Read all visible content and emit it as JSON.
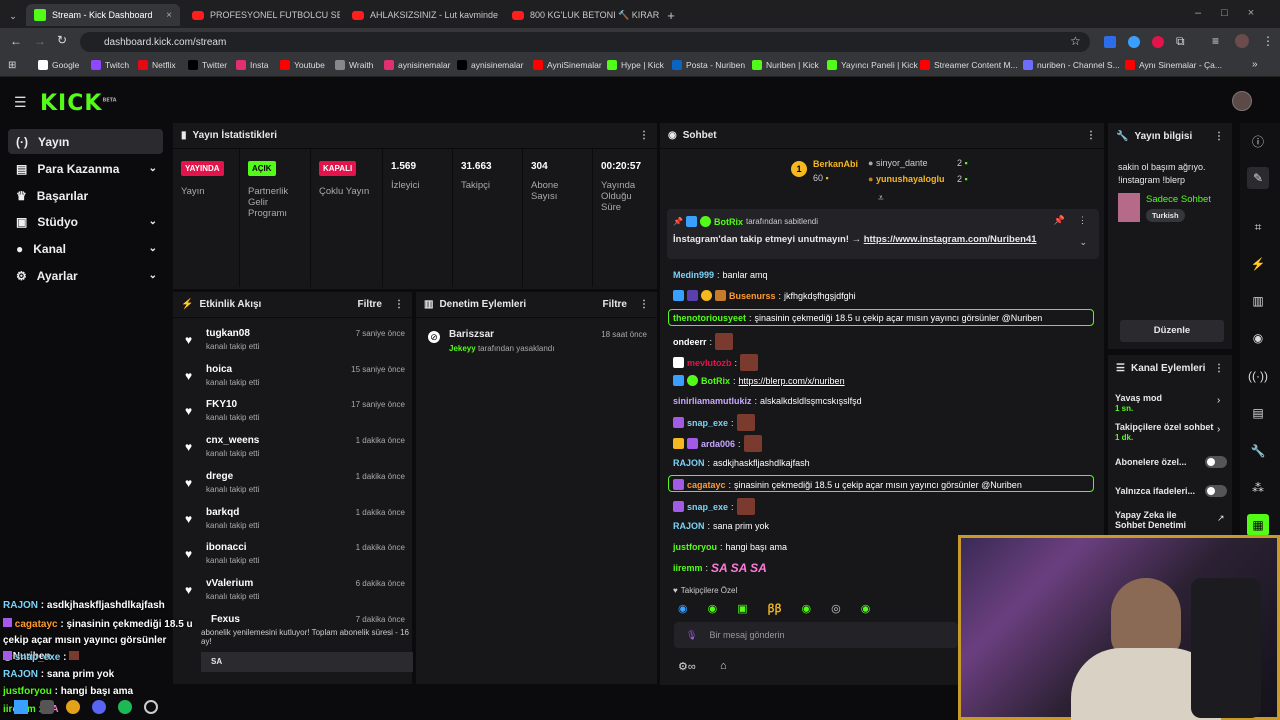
{
  "browser": {
    "tabs": [
      {
        "label": "Stream - Kick Dashboard",
        "fav": "kick"
      },
      {
        "label": "PROFESYONEL FUTBOLCU SENİ",
        "fav": "yt"
      },
      {
        "label": "AHLAKSIZSINIZ - Lut kavminde",
        "fav": "yt"
      },
      {
        "label": "800 KG'LUK BETONI 🔨 KIRAR",
        "fav": "yt"
      }
    ],
    "url": "dashboard.kick.com/stream",
    "bookmarks": [
      {
        "label": "Google",
        "color": "#ffffff"
      },
      {
        "label": "Twitch",
        "color": "#9146ff"
      },
      {
        "label": "Netflix",
        "color": "#e50914"
      },
      {
        "label": "Twitter",
        "color": "#000000"
      },
      {
        "label": "Insta",
        "color": "#e1306c"
      },
      {
        "label": "Youtube",
        "color": "#ff0000"
      },
      {
        "label": "Wraith",
        "color": "#888888"
      },
      {
        "label": "aynisinemalar",
        "color": "#e1306c"
      },
      {
        "label": "aynisinemalar",
        "color": "#000000"
      },
      {
        "label": "AyniSinemalar",
        "color": "#ff0000"
      },
      {
        "label": "Hype | Kick",
        "color": "#53fc18"
      },
      {
        "label": "Posta - Nuriben",
        "color": "#0a64c2"
      },
      {
        "label": "Nuriben | Kick",
        "color": "#53fc18"
      },
      {
        "label": "Yayıncı Paneli | Kick",
        "color": "#53fc18"
      },
      {
        "label": "Streamer Content M...",
        "color": "#ff0000"
      },
      {
        "label": "nuriben - Channel S...",
        "color": "#6d6dff"
      },
      {
        "label": "Aynı Sinemalar - Ça...",
        "color": "#ff0000"
      }
    ]
  },
  "kick": {
    "logo": "KICK",
    "beta": "BETA"
  },
  "sidebar": [
    {
      "label": "Yayın",
      "icon": "radio-icon"
    },
    {
      "label": "Para Kazanma",
      "icon": "money-icon"
    },
    {
      "label": "Başarılar",
      "icon": "trophy-icon"
    },
    {
      "label": "Stüdyo",
      "icon": "studio-icon"
    },
    {
      "label": "Kanal",
      "icon": "user-icon"
    },
    {
      "label": "Ayarlar",
      "icon": "gear-icon"
    }
  ],
  "stats": {
    "title": "Yayın İstatistikleri",
    "items": [
      {
        "badge": "YAYINDA",
        "badge_color": "#e3134b",
        "label": "Yayın"
      },
      {
        "badge": "AÇIK",
        "badge_color": "#53fc18",
        "label": "Partnerlik Gelir Programı"
      },
      {
        "badge": "KAPALI",
        "badge_color": "#e3134b",
        "label": "Çoklu Yayın"
      },
      {
        "value": "1.569",
        "label": "İzleyici"
      },
      {
        "value": "31.663",
        "label": "Takipçi"
      },
      {
        "value": "304",
        "label": "Abone Sayısı"
      },
      {
        "value": "00:20:57",
        "label": "Yayında Olduğu Süre"
      }
    ]
  },
  "activity": {
    "title": "Etkinlik Akışı",
    "filter": "Filtre",
    "events": [
      {
        "name": "tugkan08",
        "sub": "kanalı takip etti",
        "time": "7 saniye önce"
      },
      {
        "name": "hoica",
        "sub": "kanalı takip etti",
        "time": "15 saniye önce"
      },
      {
        "name": "FKY10",
        "sub": "kanalı takip etti",
        "time": "17 saniye önce"
      },
      {
        "name": "cnx_weens",
        "sub": "kanalı takip etti",
        "time": "1 dakika önce"
      },
      {
        "name": "drege",
        "sub": "kanalı takip etti",
        "time": "1 dakika önce"
      },
      {
        "name": "barkqd",
        "sub": "kanalı takip etti",
        "time": "1 dakika önce"
      },
      {
        "name": "ibonacci",
        "sub": "kanalı takip etti",
        "time": "1 dakika önce"
      },
      {
        "name": "vValerium",
        "sub": "kanalı takip etti",
        "time": "6 dakika önce"
      }
    ],
    "last": {
      "name": "Fexus",
      "time": "7 dakika önce",
      "text": "abonelik yenilemesini kutluyor! Toplam abonelik süresi - 16 ay!",
      "msg": "SA"
    }
  },
  "moderation": {
    "title": "Denetim Eylemleri",
    "filter": "Filtre",
    "item": {
      "name": "Bariszsar",
      "by": "Jekeyy",
      "text": "tarafından yasaklandı",
      "time": "18 saat önce"
    }
  },
  "chat": {
    "title": "Sohbet",
    "top": [
      {
        "rank": "1",
        "name": "BerkanAbi",
        "value": "60"
      },
      {
        "name": "sinyor_dante",
        "value": "2"
      },
      {
        "name": "yunushayaloglu",
        "value": "2"
      }
    ],
    "pinned": {
      "by": "BotRix",
      "by_text": "tarafından sabitlendi",
      "text": "İnstagram'dan takip etmeyi unutmayın! →",
      "link": "https://www.instagram.com/Nuriben41"
    },
    "messages": [
      {
        "user": "Medin999",
        "color": "#7bd3f7",
        "text": "banlar amq"
      },
      {
        "user": "Busenurss",
        "color": "#ff9a2e",
        "text": "jkfhgkdşfhgşjdfghi"
      },
      {
        "user": "thenotoriousyeet",
        "color": "#53fc18",
        "text": "şinasinin çekmediği 18.5 u çekip açar mısın yayıncı görsünler @Nuriben"
      },
      {
        "user": "ondeerr",
        "color": "#ffffff",
        "text": ""
      },
      {
        "user": "mevlutozb",
        "color": "#e3134b",
        "text": ""
      },
      {
        "user": "BotRix",
        "color": "#53fc18",
        "text": "https://blerp.com/x/nuriben"
      },
      {
        "user": "sinirliamamutlukiz",
        "color": "#c7a6ff",
        "text": "alskalkdsldlsşmcskışslfşd"
      },
      {
        "user": "snap_exe",
        "color": "#7bd3f7",
        "text": ""
      },
      {
        "user": "arda006",
        "color": "#c7a6ff",
        "text": ""
      },
      {
        "user": "RAJON",
        "color": "#7bd3f7",
        "text": "asdkjhaskfljashdlkajfash"
      },
      {
        "user": "cagatayc",
        "color": "#ff9a2e",
        "text": "şinasinin çekmediği 18.5 u çekip açar mısın yayıncı görsünler @Nuriben"
      },
      {
        "user": "snap_exe",
        "color": "#7bd3f7",
        "text": ""
      },
      {
        "user": "RAJON",
        "color": "#7bd3f7",
        "text": "sana prim yok"
      },
      {
        "user": "justforyou",
        "color": "#53fc18",
        "text": "hangi başı ama"
      },
      {
        "user": "iiremm",
        "color": "#53fc18",
        "text": "SA SA SA"
      }
    ],
    "followers_only": "Takipçilere Özel",
    "input_placeholder": "Bir mesaj gönderin"
  },
  "stream_info": {
    "title": "Yayın bilgisi",
    "stream_title": "sakin ol başım ağrıyo. !instagram !blerp",
    "category": "Sadece Sohbet",
    "tag": "Turkish",
    "edit": "Düzenle"
  },
  "channel_actions": {
    "title": "Kanal Eylemleri",
    "items": [
      {
        "label": "Yavaş mod",
        "sub": "1 sn."
      },
      {
        "label": "Takipçilere özel sohbet",
        "sub": "1 dk."
      },
      {
        "label": "Abonelere özel..."
      },
      {
        "label": "Yalnızca ifadeleri..."
      },
      {
        "label": "Yapay Zeka ile Sohbet Denetimi"
      }
    ]
  },
  "overlay_chat": [
    {
      "user": "RAJON",
      "color": "#7bd3f7",
      "text": "asdkjhaskfljashdlkajfash"
    },
    {
      "user": "cagatayc",
      "color": "#ff9a2e",
      "text": "şinasinin çekmediği 18.5 u çekip açar mısın yayıncı görsünler @Nuriben"
    },
    {
      "user": "snap_exe",
      "color": "#7bd3f7",
      "text": ""
    },
    {
      "user": "RAJON",
      "color": "#7bd3f7",
      "text": "sana prim yok"
    },
    {
      "user": "justforyou",
      "color": "#53fc18",
      "text": "hangi başı ama"
    },
    {
      "user": "iiremm",
      "color": "#53fc18",
      "text": "SA"
    }
  ]
}
